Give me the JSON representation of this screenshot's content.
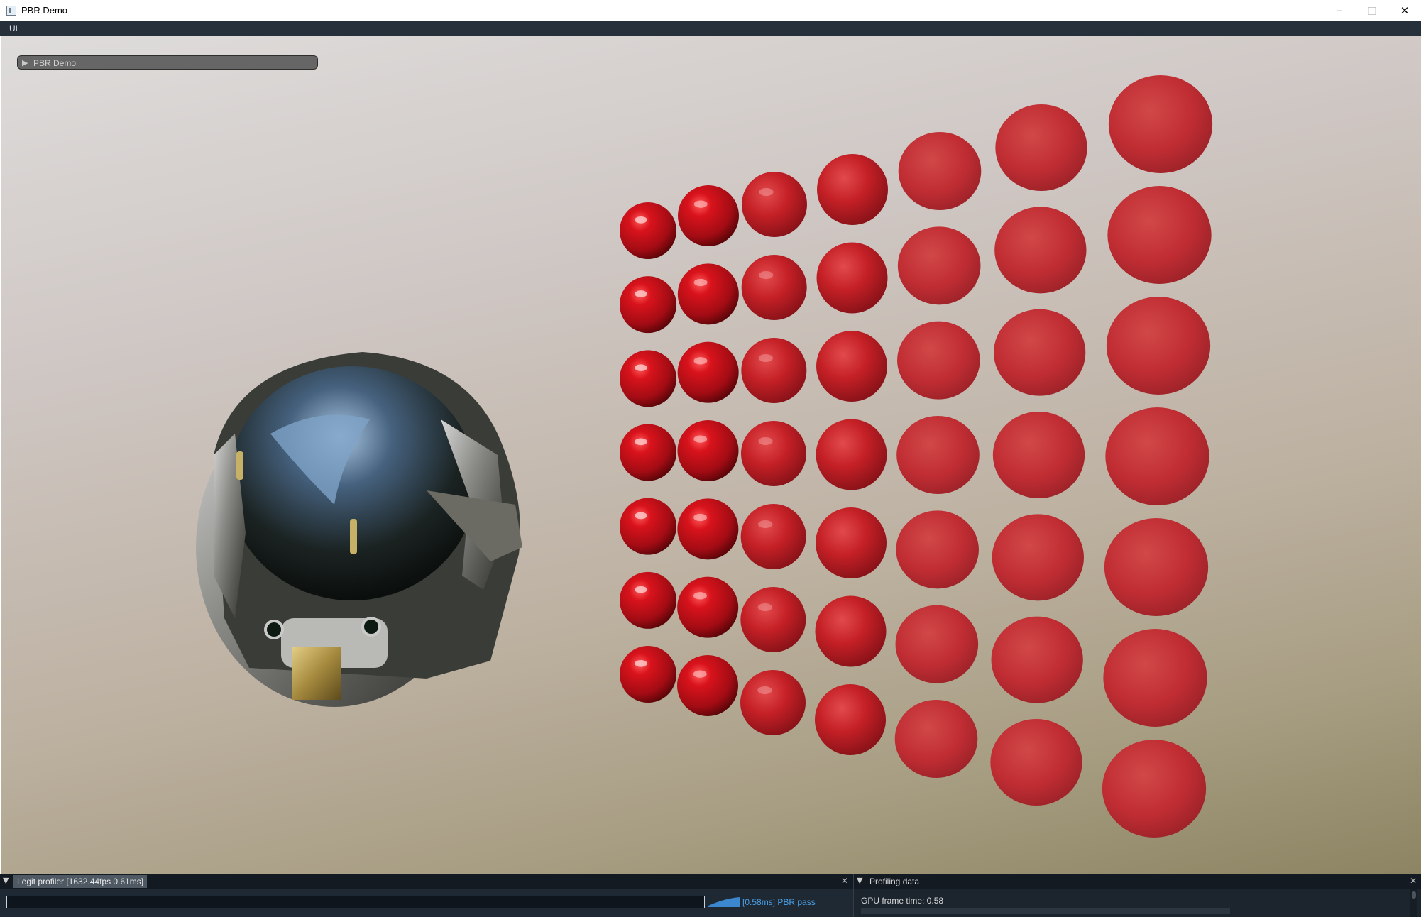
{
  "window": {
    "title": "PBR Demo",
    "minimize_glyph": "–",
    "maximize_glyph": "□",
    "close_glyph": "✕"
  },
  "menu": {
    "items": [
      "UI"
    ]
  },
  "demo_panel": {
    "arrow": "▶",
    "label": "PBR Demo"
  },
  "scene": {
    "helmet": {
      "description_icon": "helmet-model"
    },
    "sphere_grid": {
      "rows": 7,
      "columns": 7,
      "base_color": "#b0121a"
    }
  },
  "profiler": {
    "caret": "▼",
    "title": "Legit profiler [1632.44fps    0.61ms]",
    "close_glyph": "✕",
    "pass_label": "[0.58ms] PBR pass",
    "pass_color": "#4aa0e8"
  },
  "profiling_data": {
    "caret": "▼",
    "title": "Profiling data",
    "close_glyph": "✕",
    "gpu_frame_time": "GPU frame time: 0.58"
  }
}
